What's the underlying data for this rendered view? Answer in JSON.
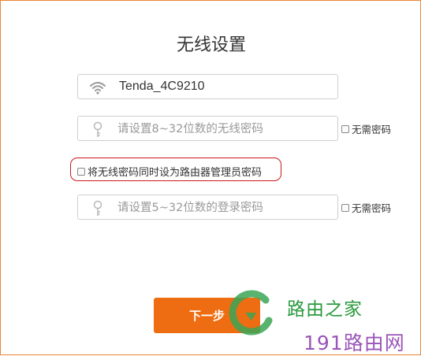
{
  "page": {
    "title": "无线设置"
  },
  "wifi": {
    "ssid": "Tenda_4C9210",
    "icon": "wifi-icon"
  },
  "wifi_password": {
    "placeholder": "请设置8~32位数的无线密码",
    "icon": "key-icon",
    "no_password_label": "无需密码"
  },
  "sync_option": {
    "label": "将无线密码同时设为路由器管理员密码",
    "highlight_color": "#c91a1a"
  },
  "admin_password": {
    "placeholder": "请设置5~32位数的登录密码",
    "icon": "key-icon",
    "no_password_label": "无需密码"
  },
  "actions": {
    "next_label": "下一步",
    "accent": "#ee6d12"
  },
  "watermark": {
    "line1": "路由之家",
    "line2": "191路由网"
  }
}
